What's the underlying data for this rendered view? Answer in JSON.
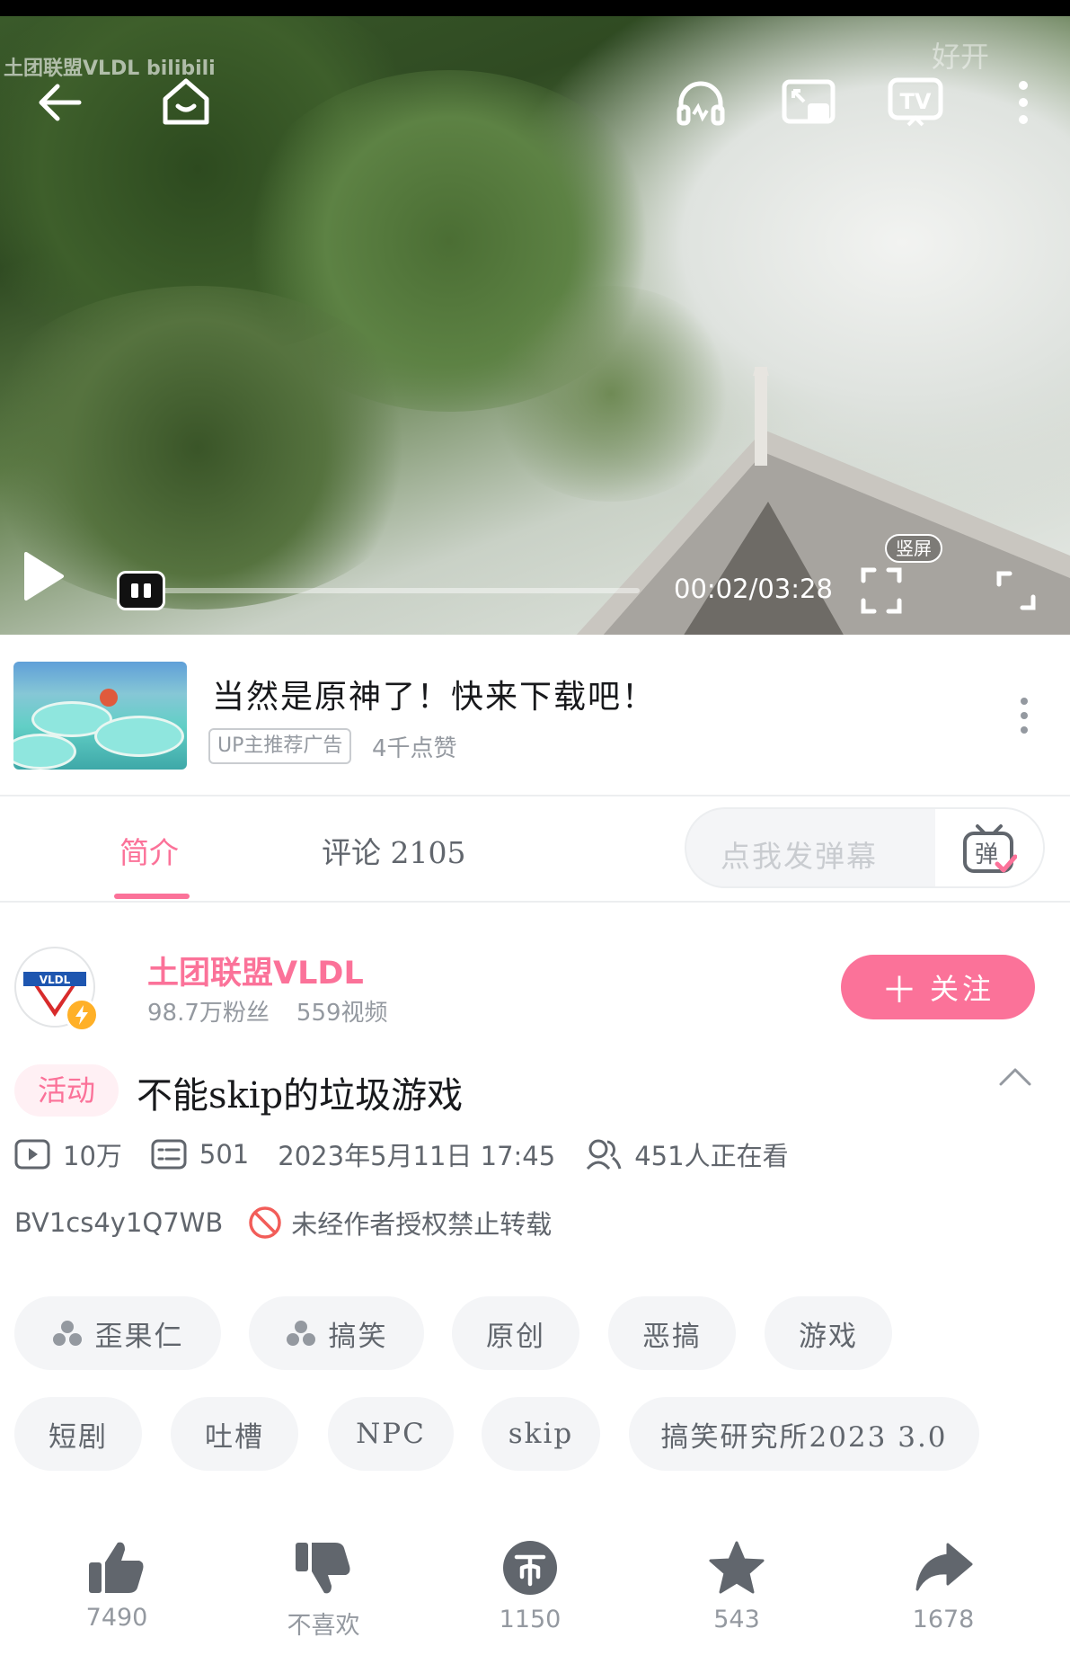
{
  "player": {
    "watermark_left": "土团联盟VLDL bilibili",
    "watermark_right": "好开",
    "time": "00:02/03:28",
    "vertical_label": "竖屏",
    "progress": 0.01,
    "icons": [
      "back-arrow-icon",
      "home-icon",
      "headphones-icon",
      "pip-icon",
      "tv-cast-icon",
      "more-icon",
      "play-icon",
      "fullscreen-bracket-icon",
      "fullscreen-icon"
    ]
  },
  "ad": {
    "title": "当然是原神了！快来下载吧！",
    "badge": "UP主推荐广告",
    "likes": "4千点赞"
  },
  "tabs": {
    "intro": "简介",
    "comments": "评论 2105",
    "danmaku_placeholder": "点我发弹幕",
    "danmaku_button": "弹"
  },
  "uploader": {
    "name": "土团联盟VLDL",
    "fans": "98.7万粉丝",
    "videos": "559视频",
    "follow_label": "关注",
    "follow_plus": "＋",
    "avatar_text": "VLDL"
  },
  "video": {
    "activity_badge": "活动",
    "title": "不能skip的垃圾游戏",
    "views": "10万",
    "danmaku_count": "501",
    "date": "2023年5月11日 17:45",
    "watching": "451人正在看",
    "bvid": "BV1cs4y1Q7WB",
    "copyright": "未经作者授权禁止转载"
  },
  "tags": [
    {
      "label": "歪果仁",
      "icon": true
    },
    {
      "label": "搞笑",
      "icon": true
    },
    {
      "label": "原创",
      "icon": false
    },
    {
      "label": "恶搞",
      "icon": false
    },
    {
      "label": "游戏",
      "icon": false
    },
    {
      "label": "短剧",
      "icon": false
    },
    {
      "label": "吐槽",
      "icon": false
    },
    {
      "label": "NPC",
      "icon": false
    },
    {
      "label": "skip",
      "icon": false
    },
    {
      "label": "搞笑研究所2023 3.0",
      "icon": false
    }
  ],
  "actions": {
    "like": "7490",
    "dislike": "不喜欢",
    "coin": "1150",
    "favorite": "543",
    "share": "1678"
  },
  "colors": {
    "accent": "#fb7299",
    "text_secondary": "#61666d",
    "text_muted": "#9499a0",
    "icon_gray": "#61666d",
    "tag_bg": "#f4f5f7"
  }
}
